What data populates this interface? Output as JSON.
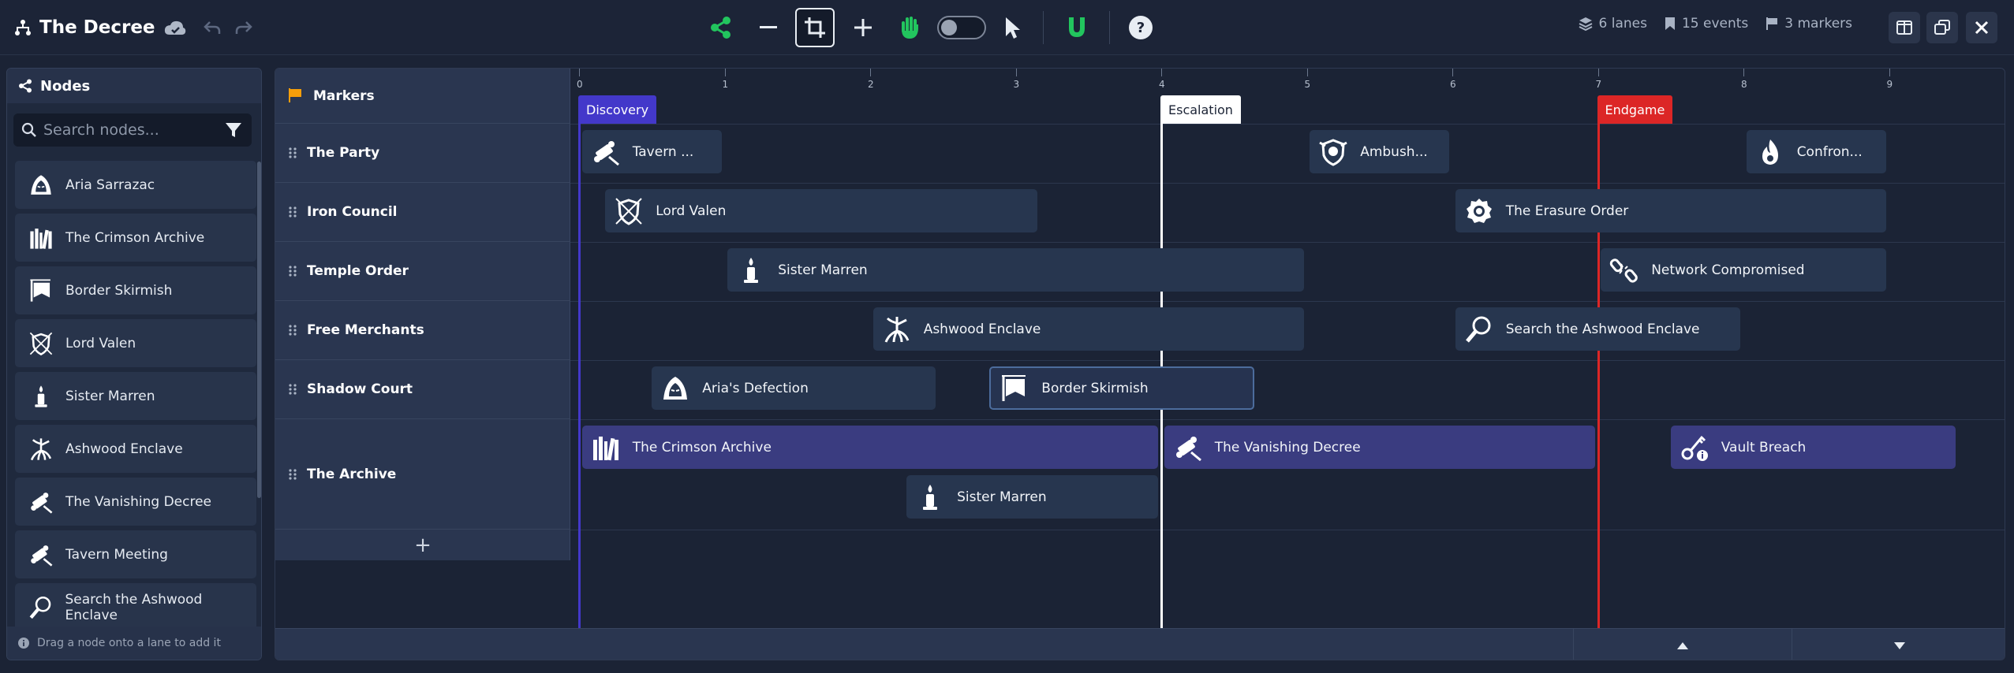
{
  "app": {
    "title": "The Decree"
  },
  "toolbar": {
    "icons": [
      "sitemap-icon",
      "cloud-sync-icon",
      "undo-icon",
      "redo-icon",
      "share-icon",
      "zoom-out-icon",
      "crop-icon",
      "zoom-in-icon",
      "hand-icon",
      "toggle-switch",
      "cursor-icon",
      "magnet-icon",
      "help-icon"
    ],
    "accent": "#22c55e"
  },
  "stats": {
    "lanes": "6 lanes",
    "events": "15 events",
    "markers": "3 markers"
  },
  "nodes_panel": {
    "title": "Nodes",
    "search_placeholder": "Search nodes...",
    "items": [
      {
        "label": "Aria Sarrazac",
        "icon": "hooded-figure-icon"
      },
      {
        "label": "The Crimson Archive",
        "icon": "bookshelf-icon"
      },
      {
        "label": "Border Skirmish",
        "icon": "banner-icon"
      },
      {
        "label": "Lord Valen",
        "icon": "shield-swords-icon"
      },
      {
        "label": "Sister Marren",
        "icon": "candle-icon"
      },
      {
        "label": "Ashwood Enclave",
        "icon": "tree-roots-icon"
      },
      {
        "label": "The Vanishing Decree",
        "icon": "scroll-quill-icon"
      },
      {
        "label": "Tavern Meeting",
        "icon": "scroll-quill-icon"
      },
      {
        "label": "Search the Ashwood Enclave",
        "icon": "magnifier-icon"
      }
    ],
    "footer": "Drag a node onto a lane to add it"
  },
  "timeline": {
    "markers_label": "Markers",
    "ticks": [
      "0",
      "1",
      "2",
      "3",
      "4",
      "5",
      "6",
      "7",
      "8",
      "9"
    ],
    "lanes": [
      {
        "name": "The Party"
      },
      {
        "name": "Iron Council"
      },
      {
        "name": "Temple Order"
      },
      {
        "name": "Free Merchants"
      },
      {
        "name": "Shadow Court"
      },
      {
        "name": "The Archive"
      }
    ],
    "markers": [
      {
        "label": "Discovery",
        "color": "#4338ca",
        "at": 0
      },
      {
        "label": "Escalation",
        "color": "#ffffff",
        "at": 4
      },
      {
        "label": "Endgame",
        "color": "#dc2626",
        "at": 7
      }
    ],
    "events": [
      {
        "label": "Tavern ...",
        "lane": 0,
        "row": 0,
        "start": 0.02,
        "end": 0.98,
        "icon": "scroll-quill-icon"
      },
      {
        "label": "Ambush...",
        "lane": 0,
        "row": 0,
        "start": 5.02,
        "end": 5.98,
        "icon": "shield-skull-icon"
      },
      {
        "label": "Confron...",
        "lane": 0,
        "row": 0,
        "start": 8.02,
        "end": 8.98,
        "icon": "fire-icon"
      },
      {
        "label": "Lord Valen",
        "lane": 1,
        "row": 0,
        "start": 0.18,
        "end": 3.15,
        "icon": "shield-swords-icon"
      },
      {
        "label": "The Erasure Order",
        "lane": 1,
        "row": 0,
        "start": 6.02,
        "end": 8.98,
        "icon": "seal-icon"
      },
      {
        "label": "Sister Marren",
        "lane": 2,
        "row": 0,
        "start": 1.02,
        "end": 4.98,
        "icon": "candle-icon"
      },
      {
        "label": "Network Compromised",
        "lane": 2,
        "row": 0,
        "start": 7.02,
        "end": 8.98,
        "icon": "broken-chain-icon"
      },
      {
        "label": "Ashwood Enclave",
        "lane": 3,
        "row": 0,
        "start": 2.02,
        "end": 4.98,
        "icon": "tree-roots-icon"
      },
      {
        "label": "Search the Ashwood Enclave",
        "lane": 3,
        "row": 0,
        "start": 6.02,
        "end": 7.98,
        "icon": "magnifier-icon"
      },
      {
        "label": "Aria's Defection",
        "lane": 4,
        "row": 0,
        "start": 0.5,
        "end": 2.45,
        "icon": "hooded-figure-icon"
      },
      {
        "label": "Border Skirmish",
        "lane": 4,
        "row": 0,
        "start": 2.82,
        "end": 4.64,
        "icon": "banner-icon",
        "selected": true
      },
      {
        "label": "The Crimson Archive",
        "lane": 5,
        "row": 0,
        "start": 0.02,
        "end": 3.98,
        "icon": "bookshelf-icon",
        "archive": true
      },
      {
        "label": "The Vanishing Decree",
        "lane": 5,
        "row": 0,
        "start": 4.02,
        "end": 6.98,
        "icon": "scroll-quill-icon",
        "archive": true
      },
      {
        "label": "Vault Breach",
        "lane": 5,
        "row": 0,
        "start": 7.5,
        "end": 9.46,
        "icon": "key-info-icon",
        "archive": true
      },
      {
        "label": "Sister Marren",
        "lane": 5,
        "row": 1,
        "start": 2.25,
        "end": 3.98,
        "icon": "candle-icon"
      }
    ]
  }
}
